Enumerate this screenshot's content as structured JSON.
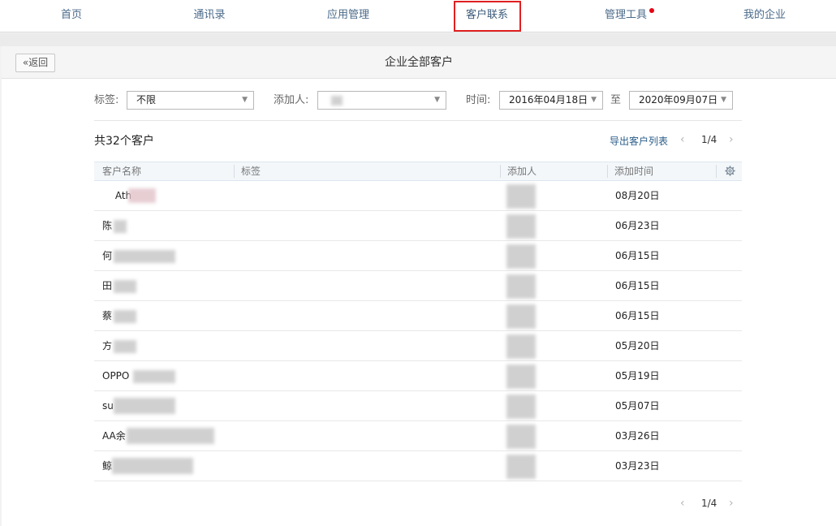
{
  "nav": {
    "items": [
      {
        "label": "首页"
      },
      {
        "label": "通讯录"
      },
      {
        "label": "应用管理"
      },
      {
        "label": "客户联系"
      },
      {
        "label": "管理工具"
      },
      {
        "label": "我的企业"
      }
    ],
    "active_index": 3,
    "notification_dot_on": "管理工具",
    "highlight_color": "#e02020"
  },
  "panel": {
    "back_label": "返回",
    "title": "企业全部客户"
  },
  "filters": {
    "tag_label": "标签:",
    "tag_value": "不限",
    "adder_label": "添加人:",
    "adder_value": "",
    "time_label": "时间:",
    "start_date": "2016年04月18日",
    "to_label": "至",
    "end_date": "2020年09月07日"
  },
  "summary": {
    "count_text": "共32个客户",
    "export_label": "导出客户列表",
    "page_text": "1/4"
  },
  "table": {
    "columns": [
      "客户名称",
      "标签",
      "添加人",
      "添加时间"
    ],
    "rows": [
      {
        "name": "  Ath",
        "date": "08月20日"
      },
      {
        "name": "陈",
        "date": "06月23日"
      },
      {
        "name": "何",
        "date": "06月15日"
      },
      {
        "name": "田",
        "date": "06月15日"
      },
      {
        "name": "蔡",
        "date": "06月15日"
      },
      {
        "name": "方",
        "date": "05月20日"
      },
      {
        "name": "OPPO",
        "date": "05月19日"
      },
      {
        "name": "su",
        "date": "05月07日"
      },
      {
        "name": "AA余",
        "date": "03月26日"
      },
      {
        "name": "鲸",
        "date": "03月23日"
      }
    ]
  },
  "footer": {
    "page_text": "1/4"
  },
  "colors": {
    "nav_text": "#4a6a8a",
    "link": "#2b5d8a",
    "red_dot": "#e60012"
  }
}
